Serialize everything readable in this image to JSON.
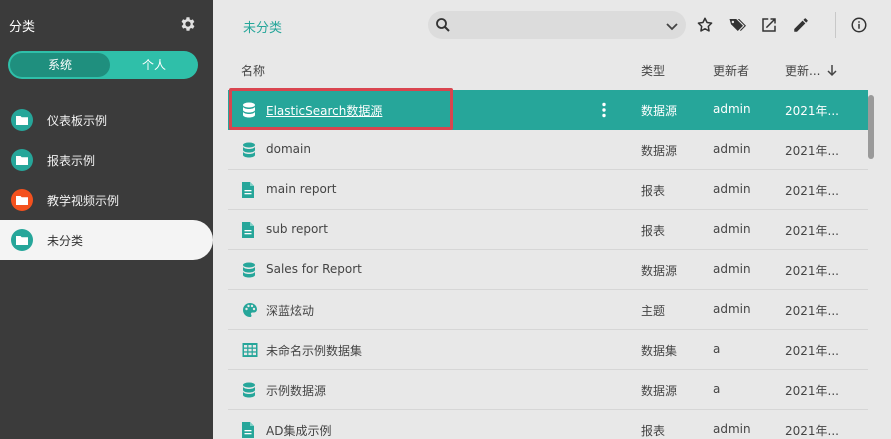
{
  "sidebar": {
    "title": "分类",
    "segment": {
      "system": "系统",
      "personal": "个人",
      "selected": "系统"
    },
    "items": [
      {
        "label": "仪表板示例",
        "color": "#26a69a"
      },
      {
        "label": "报表示例",
        "color": "#26a69a"
      },
      {
        "label": "教学视频示例",
        "color": "#f4511e"
      },
      {
        "label": "未分类",
        "color": "#26a69a",
        "active": true
      }
    ]
  },
  "header": {
    "breadcrumb": "未分类",
    "search": {
      "value": "",
      "placeholder": ""
    }
  },
  "table": {
    "columns": {
      "name": "名称",
      "type": "类型",
      "updater": "更新者",
      "updated": "更新..."
    },
    "rows": [
      {
        "icon": "database-icon",
        "name": "ElasticSearch数据源",
        "type": "数据源",
        "updater": "admin",
        "updated": "2021年...",
        "selected": true
      },
      {
        "icon": "database-icon",
        "name": "domain",
        "type": "数据源",
        "updater": "admin",
        "updated": "2021年..."
      },
      {
        "icon": "document-icon",
        "name": "main report",
        "type": "报表",
        "updater": "admin",
        "updated": "2021年..."
      },
      {
        "icon": "document-icon",
        "name": "sub report",
        "type": "报表",
        "updater": "admin",
        "updated": "2021年..."
      },
      {
        "icon": "database-icon",
        "name": "Sales for Report",
        "type": "数据源",
        "updater": "admin",
        "updated": "2021年..."
      },
      {
        "icon": "palette-icon",
        "name": "深蓝炫动",
        "type": "主题",
        "updater": "admin",
        "updated": "2021年..."
      },
      {
        "icon": "table-icon",
        "name": "未命名示例数据集",
        "type": "数据集",
        "updater": "a",
        "updated": "2021年..."
      },
      {
        "icon": "database-icon",
        "name": "示例数据源",
        "type": "数据源",
        "updater": "a",
        "updated": "2021年..."
      },
      {
        "icon": "document-icon",
        "name": "AD集成示例",
        "type": "报表",
        "updater": "admin",
        "updated": "2021年..."
      }
    ]
  },
  "colors": {
    "accent": "#26a69a",
    "sidebar_bg": "#3b3b3b",
    "highlight": "#d9454f"
  }
}
